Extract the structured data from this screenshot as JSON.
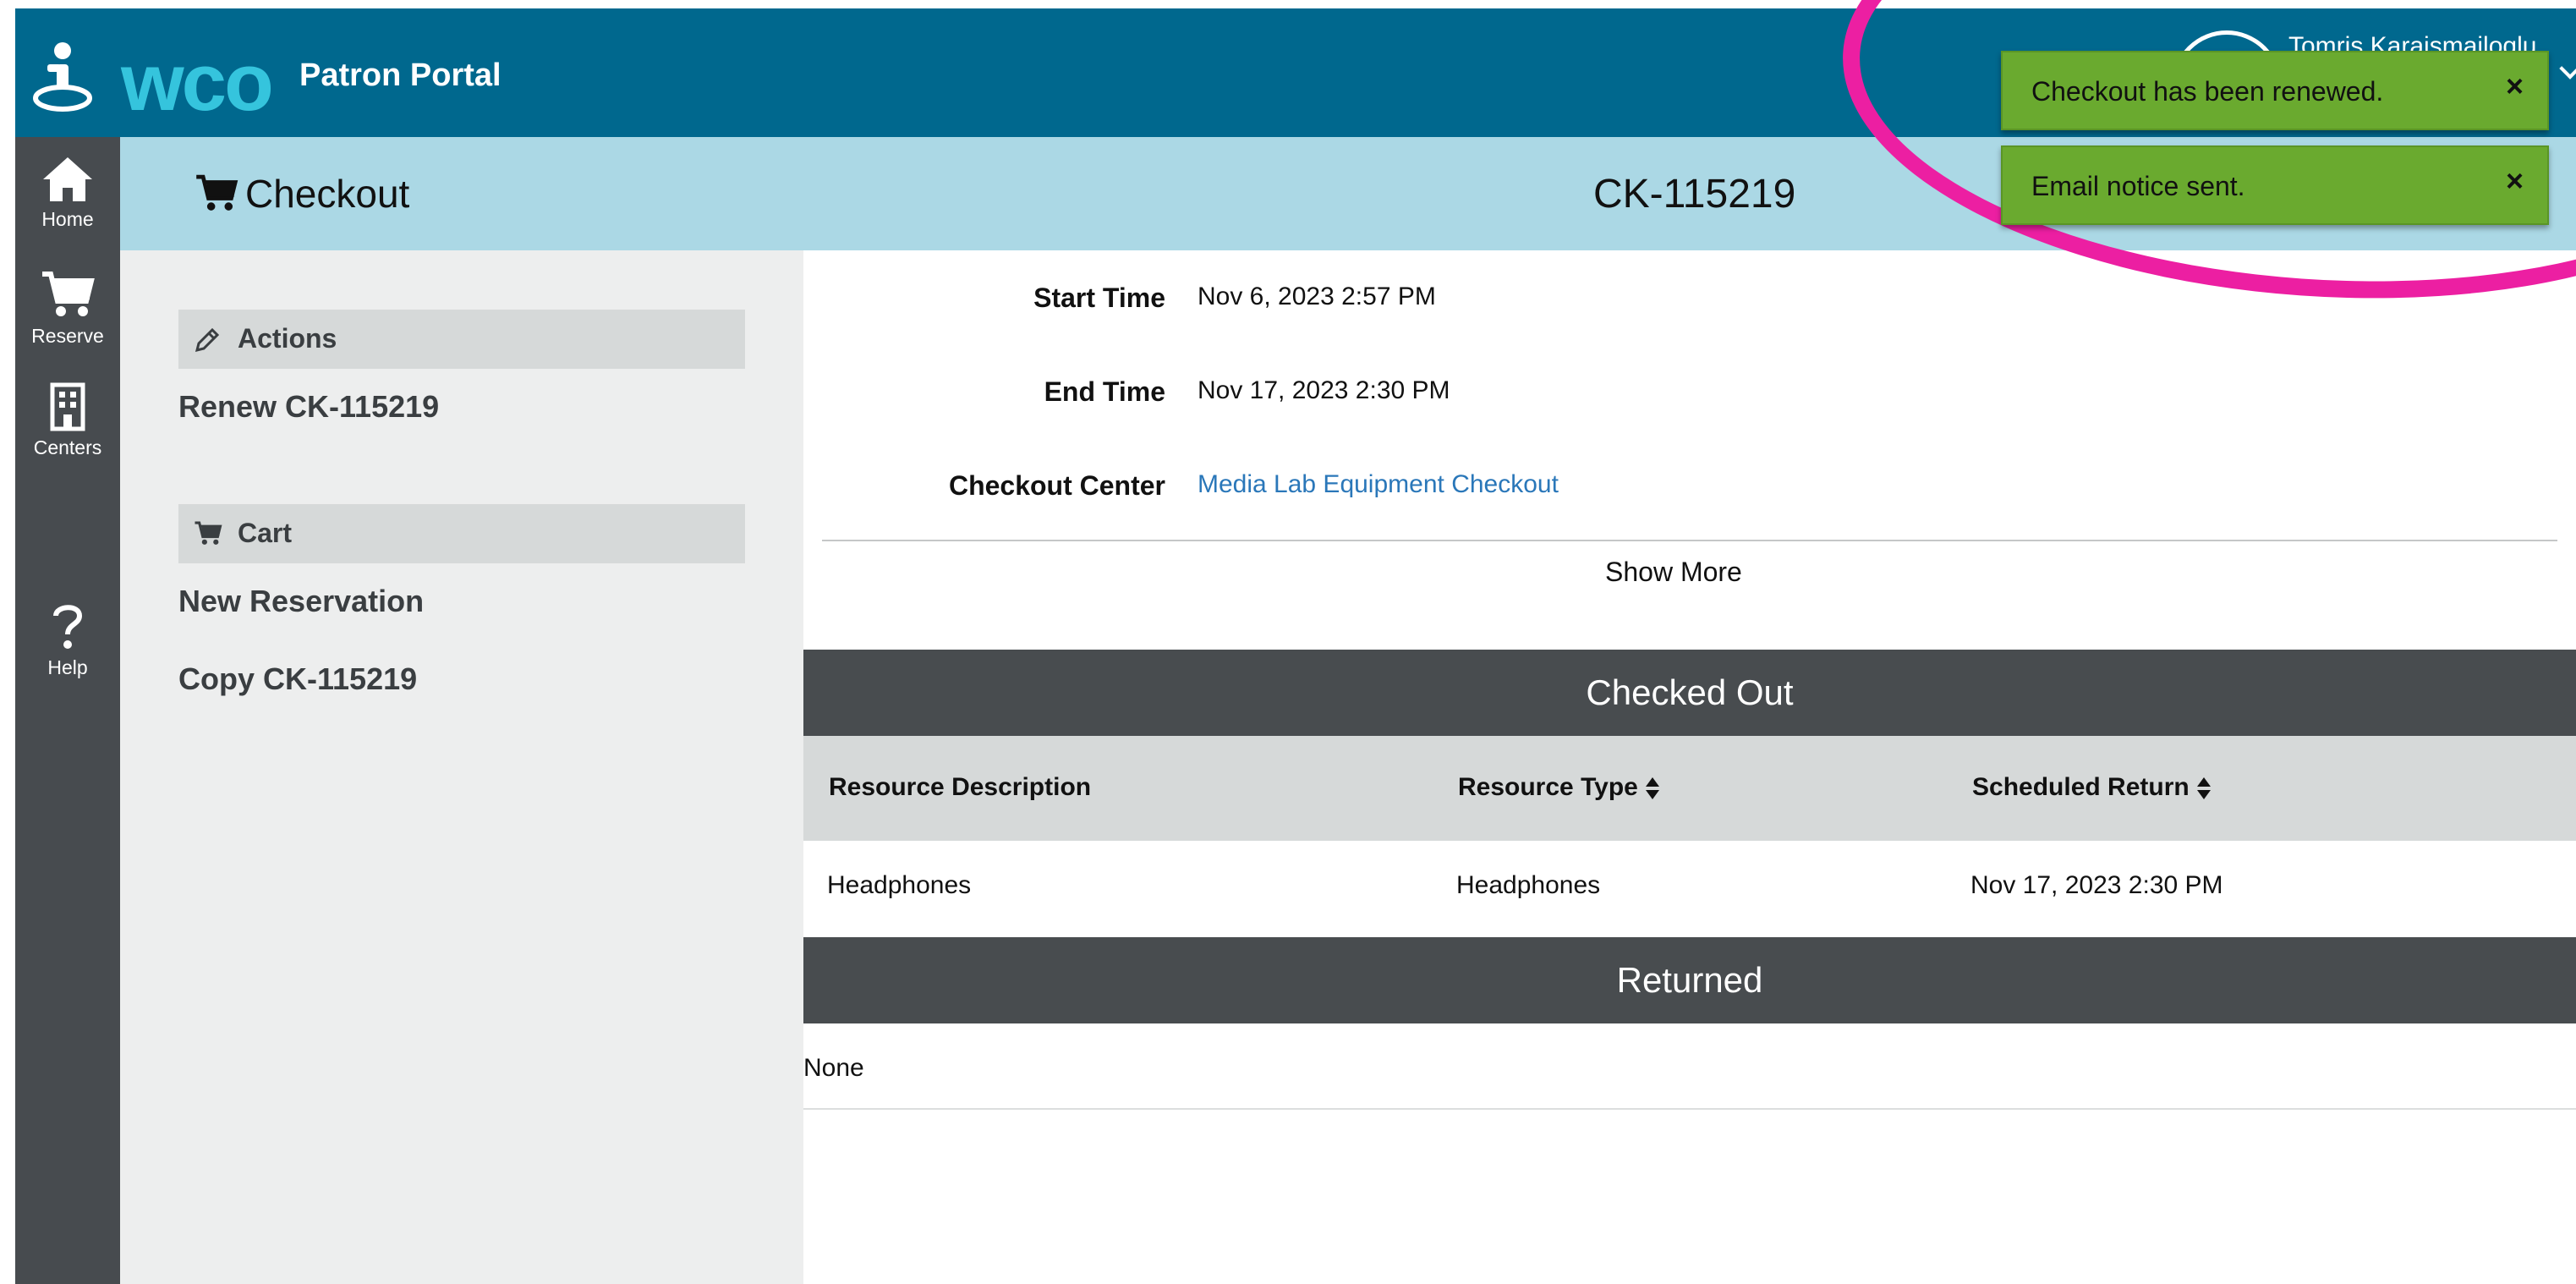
{
  "header": {
    "logo_text": "wco",
    "portal_title": "Patron Portal",
    "user_name": "Tomris Karaismailoglu",
    "colors": {
      "header_bg": "#00688e",
      "logo": "#35c4dd"
    }
  },
  "nav": {
    "items": [
      {
        "label": "Home",
        "icon": "home-icon"
      },
      {
        "label": "Reserve",
        "icon": "cart-icon"
      },
      {
        "label": "Centers",
        "icon": "building-icon"
      },
      {
        "label": "Help",
        "icon": "question-icon"
      }
    ]
  },
  "titlebar": {
    "title": "Checkout",
    "checkout_id": "CK-115219"
  },
  "side": {
    "actions_header": "Actions",
    "renew_link": "Renew CK-115219",
    "cart_header": "Cart",
    "new_reservation": "New Reservation",
    "copy_link": "Copy CK-115219"
  },
  "details": {
    "start_time_label": "Start Time",
    "start_time_value": "Nov 6, 2023 2:57 PM",
    "end_time_label": "End Time",
    "end_time_value": "Nov 17, 2023 2:30 PM",
    "center_label": "Checkout Center",
    "center_value": "Media Lab Equipment Checkout",
    "show_more": "Show More"
  },
  "checked_out": {
    "heading": "Checked Out",
    "columns": [
      "Resource Description",
      "Resource Type",
      "Scheduled Return"
    ],
    "rows": [
      [
        "Headphones",
        "Headphones",
        "Nov 17, 2023 2:30 PM"
      ]
    ]
  },
  "returned": {
    "heading": "Returned",
    "empty_text": "None"
  },
  "toasts": [
    {
      "message": "Checkout has been renewed.",
      "close": "×"
    },
    {
      "message": "Email notice sent.",
      "close": "×"
    }
  ],
  "annotation_color": "#ec1fa2"
}
